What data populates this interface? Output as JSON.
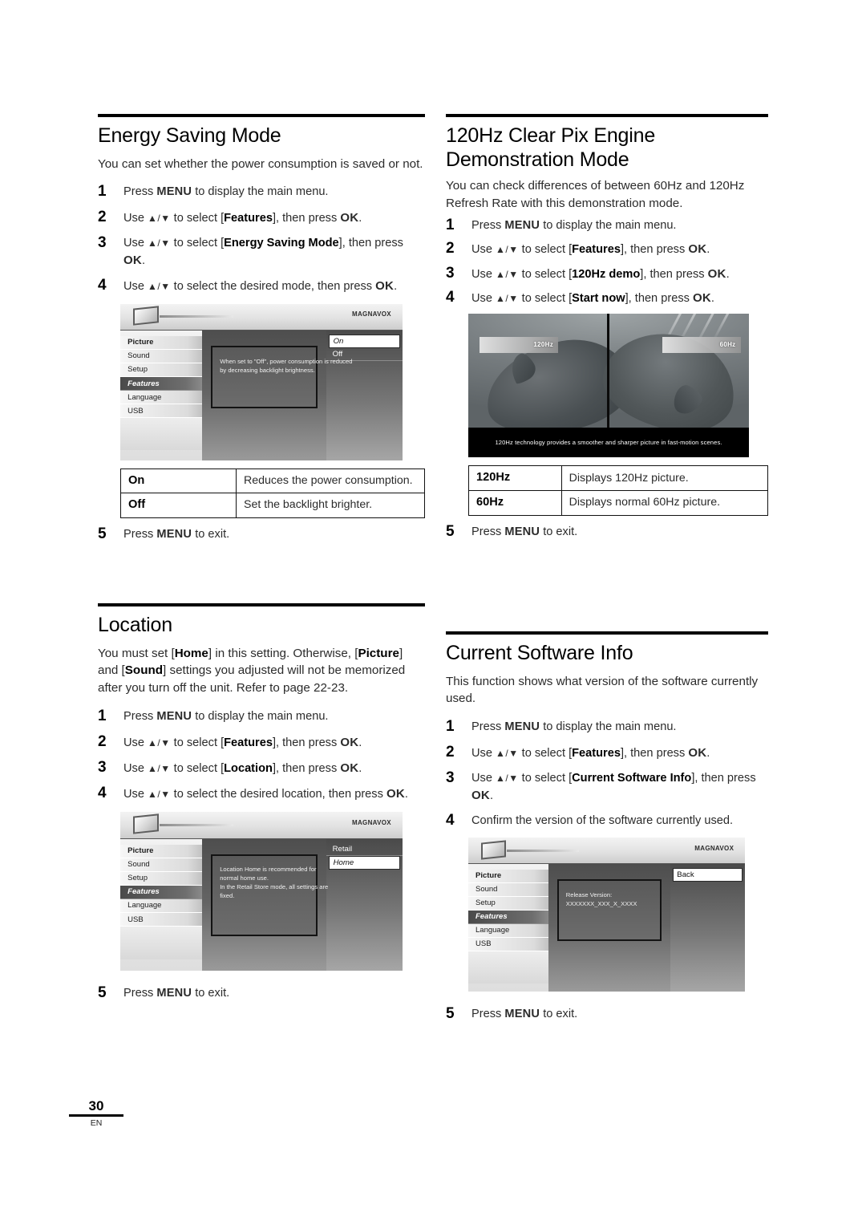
{
  "page": {
    "number": "30",
    "language_code": "EN"
  },
  "sections": {
    "energy_saving": {
      "heading": "Energy Saving Mode",
      "intro": "You can set whether the power consumption is saved or not.",
      "steps": [
        {
          "num": "1",
          "text": "Press MENU to display the main menu."
        },
        {
          "num": "2",
          "text": "Use ▲/▼ to select [Features], then press OK."
        },
        {
          "num": "3",
          "text": "Use ▲/▼ to select [Energy Saving Mode], then press OK."
        },
        {
          "num": "4",
          "text": "Use ▲/▼ to select the desired mode, then press OK."
        }
      ],
      "osd": {
        "brand": "MAGNAVOX",
        "menu_items": [
          "Picture",
          "Sound",
          "Setup",
          "Features",
          "Language",
          "USB"
        ],
        "active_menu": "Features",
        "note_line1": "When set to \"Off\", power consumption is reduced",
        "note_line2": "by decreasing backlight brightness.",
        "options": [
          "On",
          "Off"
        ],
        "selected_option": "On"
      },
      "table": {
        "rows": [
          {
            "key": "On",
            "desc": "Reduces the power consumption."
          },
          {
            "key": "Off",
            "desc": "Set the backlight brighter."
          }
        ]
      },
      "final_step": {
        "num": "5",
        "text": "Press MENU to exit."
      }
    },
    "clear_pix": {
      "heading_line1": "120Hz Clear Pix Engine",
      "heading_line2": "Demonstration Mode",
      "intro": "You can check differences of between 60Hz and 120Hz Refresh Rate with this demonstration mode.",
      "steps": [
        {
          "num": "1",
          "text": "Press MENU to display the main menu."
        },
        {
          "num": "2",
          "text": "Use ▲/▼ to select [Features], then press OK."
        },
        {
          "num": "3",
          "text": "Use ▲/▼ to select [120Hz demo], then press OK."
        },
        {
          "num": "4",
          "text": "Use ▲/▼ to select [Start now], then press OK."
        }
      ],
      "demo_image": {
        "left_label": "120Hz",
        "right_label": "60Hz",
        "caption": "120Hz technology provides a smoother and sharper picture in fast-motion scenes."
      },
      "table": {
        "rows": [
          {
            "key": "120Hz",
            "desc": "Displays 120Hz picture."
          },
          {
            "key": "60Hz",
            "desc": "Displays normal 60Hz picture."
          }
        ]
      },
      "final_step": {
        "num": "5",
        "text": "Press MENU to exit."
      }
    },
    "location": {
      "heading": "Location",
      "intro": "You must set [Home] in this setting. Otherwise, [Picture] and [Sound] settings you adjusted will not be memorized after you turn off the unit. Refer to page 22-23.",
      "steps": [
        {
          "num": "1",
          "text": "Press MENU to display the main menu."
        },
        {
          "num": "2",
          "text": "Use ▲/▼ to select [Features], then press OK."
        },
        {
          "num": "3",
          "text": "Use ▲/▼ to select [Location], then press OK."
        },
        {
          "num": "4",
          "text": "Use ▲/▼ to select the desired location, then press OK."
        }
      ],
      "osd": {
        "brand": "MAGNAVOX",
        "menu_items": [
          "Picture",
          "Sound",
          "Setup",
          "Features",
          "Language",
          "USB"
        ],
        "active_menu": "Features",
        "note_line1": "Location Home is recommended for",
        "note_line2": "normal home use.",
        "note_line3": "In the Retail Store mode, all settings are",
        "note_line4": "fixed.",
        "options": [
          "Retail",
          "Home"
        ],
        "selected_option": "Home"
      },
      "final_step": {
        "num": "5",
        "text": "Press MENU to exit."
      }
    },
    "software_info": {
      "heading": "Current Software Info",
      "intro": "This function shows what version of the software currently used.",
      "steps": [
        {
          "num": "1",
          "text": "Press MENU to display the main menu."
        },
        {
          "num": "2",
          "text": "Use ▲/▼ to select [Features], then press OK."
        },
        {
          "num": "3",
          "text": "Use ▲/▼ to select [Current Software Info], then press OK."
        },
        {
          "num": "4",
          "text": "Confirm the version of the software currently used."
        }
      ],
      "osd": {
        "brand": "MAGNAVOX",
        "menu_items": [
          "Picture",
          "Sound",
          "Setup",
          "Features",
          "Language",
          "USB"
        ],
        "active_menu": "Features",
        "note_line1": "Release Version:",
        "note_line2": "XXXXXXX_XXX_X_XXXX",
        "options": [
          "Back"
        ],
        "selected_option": "Back"
      },
      "final_step": {
        "num": "5",
        "text": "Press MENU to exit."
      }
    }
  }
}
